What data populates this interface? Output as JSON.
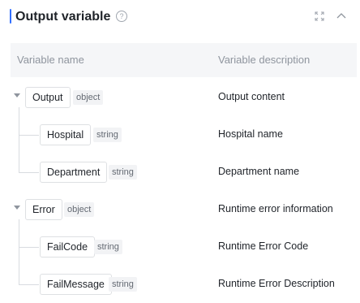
{
  "header": {
    "title": "Output variable",
    "help_icon": "question-circle-icon",
    "expand_icon": "expand-icon",
    "collapse_icon": "chevron-up-icon",
    "accent_color": "#3370ff"
  },
  "table": {
    "columns": [
      "Variable name",
      "Variable description"
    ]
  },
  "variables": [
    {
      "name": "Output",
      "type": "object",
      "description": "Output content",
      "children": [
        {
          "name": "Hospital",
          "type": "string",
          "description": "Hospital name"
        },
        {
          "name": "Department",
          "type": "string",
          "description": "Department name"
        }
      ]
    },
    {
      "name": "Error",
      "type": "object",
      "description": "Runtime error information",
      "children": [
        {
          "name": "FailCode",
          "type": "string",
          "description": "Runtime Error Code"
        },
        {
          "name": "FailMessage",
          "type": "string",
          "description": "Runtime Error Description"
        }
      ]
    }
  ]
}
